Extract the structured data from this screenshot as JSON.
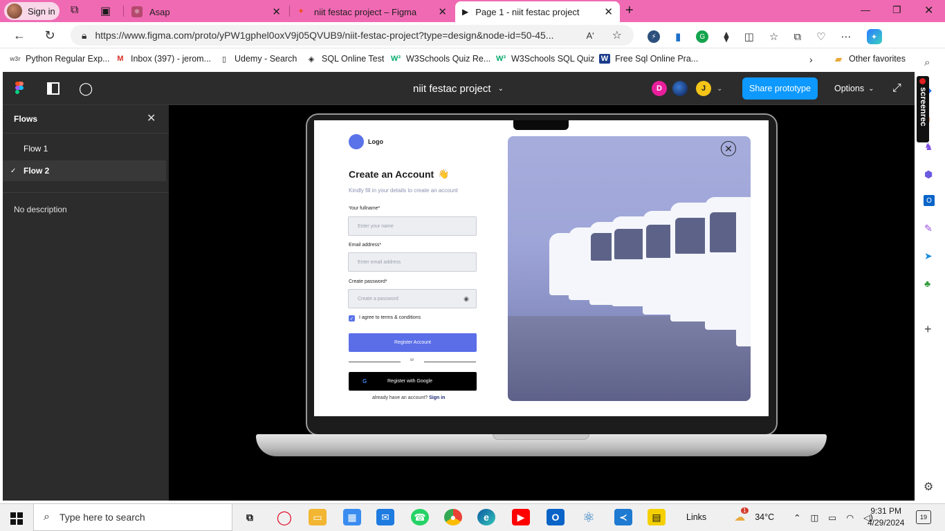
{
  "browser": {
    "profile_label": "Sign in",
    "tabs": [
      {
        "title": "Asap",
        "icon": "react-icon"
      },
      {
        "title": "niit festac project – Figma",
        "icon": "figma-icon"
      },
      {
        "title": "Page 1 - niit festac project",
        "icon": "play-icon"
      }
    ],
    "url": "https://www.figma.com/proto/yPW1gphel0oxV9j05QVUB9/niit-festac-project?type=design&node-id=50-45...",
    "bookmarks": [
      {
        "label": "Python Regular Exp...",
        "icon": "w3r"
      },
      {
        "label": "Inbox (397) - jerom...",
        "icon": "M"
      },
      {
        "label": "Udemy - Search",
        "icon": "doc"
      },
      {
        "label": "SQL Online Test",
        "icon": "diamond"
      },
      {
        "label": "W3Schools Quiz Re...",
        "icon": "W3"
      },
      {
        "label": "W3Schools SQL Quiz",
        "icon": "W3"
      },
      {
        "label": "Free Sql Online Pra...",
        "icon": "W"
      }
    ],
    "other_favorites": "Other favorites",
    "read_aloud": "Aʹ"
  },
  "figma": {
    "project_title": "niit festac project",
    "avatars": [
      "D",
      "J"
    ],
    "share_label": "Share prototype",
    "options_label": "Options",
    "flows_header": "Flows",
    "flows": [
      "Flow 1",
      "Flow 2"
    ],
    "selected_flow_index": 1,
    "no_description": "No description"
  },
  "design": {
    "logo": "Logo",
    "heading": "Create an Account",
    "wave": "👋",
    "subheading": "Kindly fill in your details to create an account",
    "fullname_label": "Your fullname*",
    "fullname_placeholder": "Enter your name",
    "email_label": "Email address*",
    "email_placeholder": "Enter email address",
    "password_label": "Create password*",
    "password_placeholder": "Create a password",
    "terms_label": "I agree to terms & conditions",
    "register_button": "Register Account",
    "or": "or",
    "google_button": "Register with Google",
    "already_text": "already have an account?",
    "sign_in": "Sign in"
  },
  "screenrec": "screenrec",
  "taskbar": {
    "search_placeholder": "Type here to search",
    "links": "Links",
    "weather": "34°C",
    "weather_badge": "1",
    "time": "9:31 PM",
    "date": "4/29/2024",
    "notifications": "19"
  },
  "colors": {
    "tab_strip": "#f06ab3",
    "figma_panel": "#2c2c2c",
    "share_blue": "#0d99ff",
    "accent": "#5b6ee8"
  }
}
